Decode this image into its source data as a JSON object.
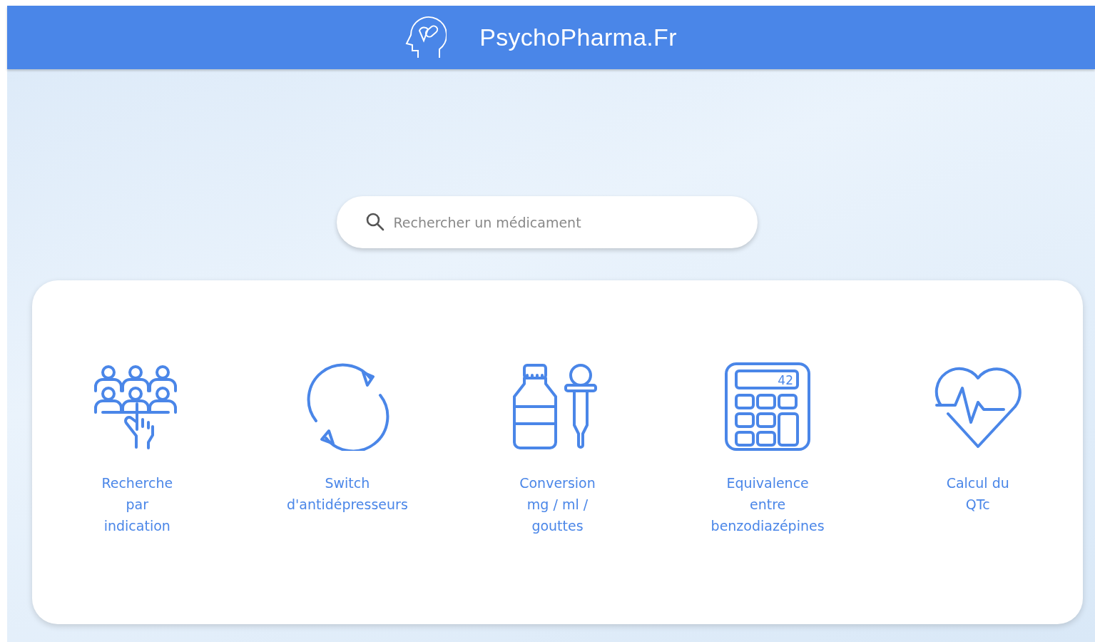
{
  "header": {
    "title": "PsychoPharma.Fr"
  },
  "search": {
    "placeholder": "Rechercher un médicament"
  },
  "tools": [
    {
      "kind": "people",
      "lines": [
        "Recherche",
        "par",
        "indication"
      ]
    },
    {
      "kind": "cycle",
      "lines": [
        "Switch",
        "d'antidépresseurs"
      ]
    },
    {
      "kind": "bottle",
      "lines": [
        "Conversion",
        "mg / ml /",
        "gouttes"
      ]
    },
    {
      "kind": "calculator",
      "display": "42",
      "lines": [
        "Equivalence",
        "entre",
        "benzodiazépines"
      ]
    },
    {
      "kind": "heart",
      "lines": [
        "Calcul du",
        "QTc"
      ]
    }
  ]
}
